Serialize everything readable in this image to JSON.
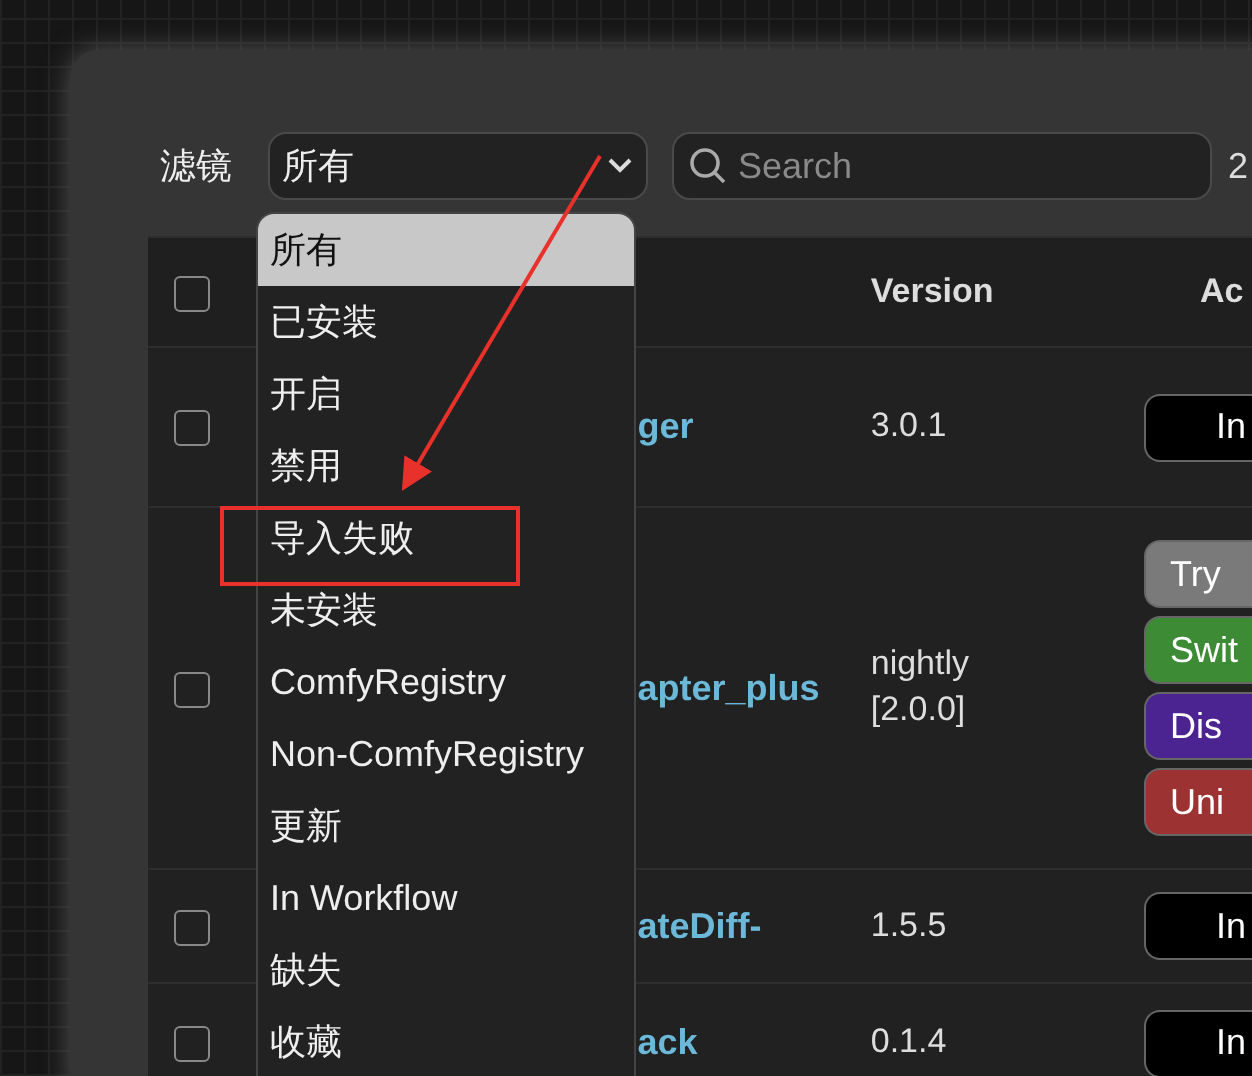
{
  "filter": {
    "label": "滤镜",
    "value": "所有",
    "options": [
      {
        "label": "所有",
        "selected": true,
        "highlighted": false
      },
      {
        "label": "已安装",
        "selected": false,
        "highlighted": false
      },
      {
        "label": "开启",
        "selected": false,
        "highlighted": false
      },
      {
        "label": "禁用",
        "selected": false,
        "highlighted": false
      },
      {
        "label": "导入失败",
        "selected": false,
        "highlighted": true
      },
      {
        "label": "未安装",
        "selected": false,
        "highlighted": false
      },
      {
        "label": "ComfyRegistry",
        "selected": false,
        "highlighted": false
      },
      {
        "label": "Non-ComfyRegistry",
        "selected": false,
        "highlighted": false
      },
      {
        "label": "更新",
        "selected": false,
        "highlighted": false
      },
      {
        "label": "In Workflow",
        "selected": false,
        "highlighted": false
      },
      {
        "label": "缺失",
        "selected": false,
        "highlighted": false
      },
      {
        "label": "收藏",
        "selected": false,
        "highlighted": false
      }
    ]
  },
  "search": {
    "placeholder": "Search"
  },
  "count": "2",
  "table": {
    "header": {
      "checked": false,
      "version": "Version",
      "action": "Ac"
    },
    "rows": [
      {
        "checked": false,
        "name": "ger",
        "version": "3.0.1",
        "actions": [
          {
            "label": "In",
            "kind": "install"
          }
        ]
      },
      {
        "checked": false,
        "name": "apter_plus",
        "version": "nightly [2.0.0]",
        "actions": [
          {
            "label": "Try",
            "kind": "try"
          },
          {
            "label": "Swit",
            "kind": "switch"
          },
          {
            "label": "Dis",
            "kind": "disable"
          },
          {
            "label": "Uni",
            "kind": "uninstall"
          }
        ]
      },
      {
        "checked": false,
        "name": "ateDiff-",
        "version": "1.5.5",
        "actions": [
          {
            "label": "In",
            "kind": "install"
          }
        ]
      },
      {
        "checked": false,
        "name": "ack",
        "version": "0.1.4",
        "actions": [
          {
            "label": "In",
            "kind": "install"
          }
        ]
      }
    ]
  }
}
